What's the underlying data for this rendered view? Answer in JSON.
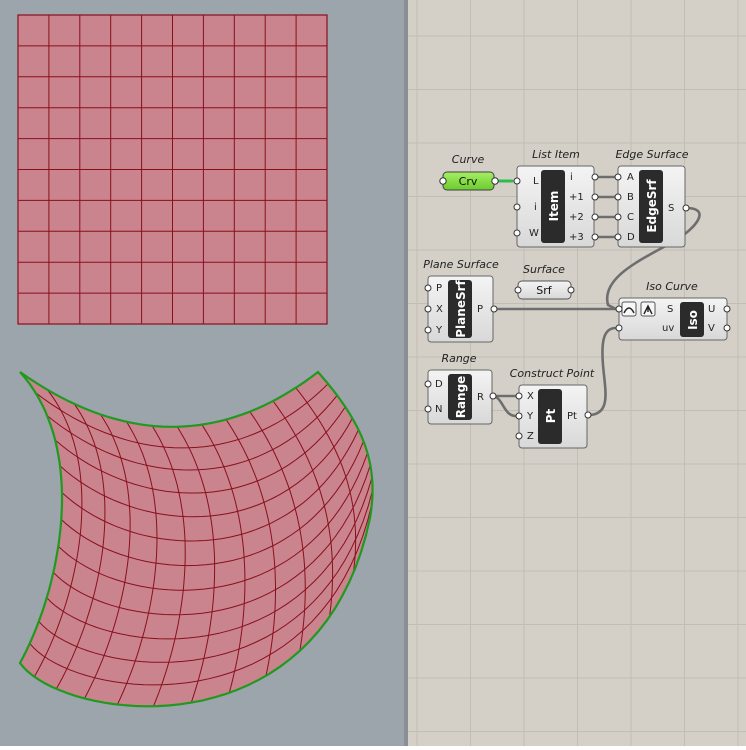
{
  "colors": {
    "viewport_bg": "#9ca4ac",
    "canvas_bg": "#d4d0c8",
    "grid_line": "#c2beb6",
    "surface_fill": "#c9848e",
    "surface_line": "#8a0f1c",
    "edge_green": "#1f9a1f",
    "param_green": "#7ddc3a",
    "wire": "#6e6e6e",
    "component_body": "#e9e9e9",
    "component_label": "#2a2a2a"
  },
  "grid_counts": {
    "flat_u": 10,
    "flat_v": 10,
    "curved_u": 12,
    "curved_v": 12
  },
  "components": {
    "curve": {
      "title": "Curve",
      "label": "Crv"
    },
    "list_item": {
      "title": "List Item",
      "label": "Item",
      "inputs": [
        "L",
        "i",
        "W"
      ],
      "outputs": [
        "i",
        "+1",
        "+2",
        "+3"
      ]
    },
    "edge_surface": {
      "title": "Edge Surface",
      "label": "EdgeSrf",
      "inputs": [
        "A",
        "B",
        "C",
        "D"
      ],
      "outputs": [
        "S"
      ]
    },
    "plane_surface": {
      "title": "Plane Surface",
      "label": "PlaneSrf",
      "inputs": [
        "P",
        "X",
        "Y"
      ],
      "outputs": [
        "P"
      ]
    },
    "surface": {
      "title": "Surface",
      "label": "Srf"
    },
    "iso_curve": {
      "title": "Iso Curve",
      "label": "Iso",
      "inputs": [
        "S",
        "uv"
      ],
      "outputs": [
        "U",
        "V"
      ]
    },
    "range": {
      "title": "Range",
      "label": "Range",
      "inputs": [
        "D",
        "N"
      ],
      "outputs": [
        "R"
      ]
    },
    "construct_point": {
      "title": "Construct Point",
      "label": "Pt",
      "inputs": [
        "X",
        "Y",
        "Z"
      ],
      "outputs": [
        "Pt"
      ]
    }
  }
}
